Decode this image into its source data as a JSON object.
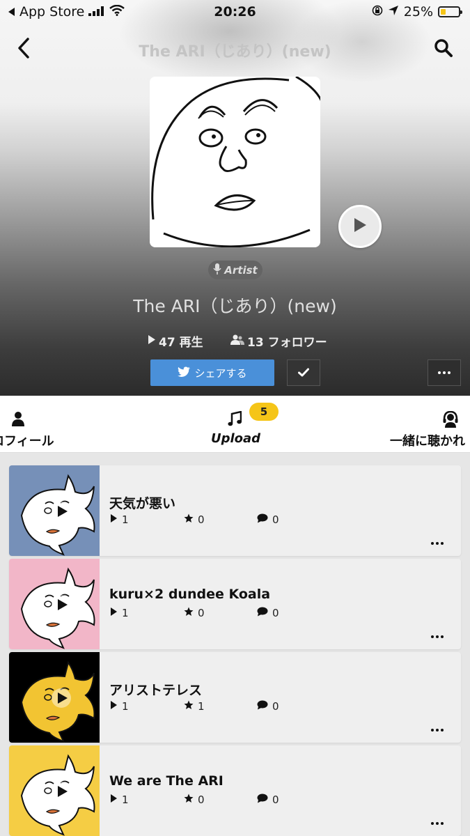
{
  "status_bar": {
    "back_app": "App Store",
    "time": "20:26",
    "battery": "25%"
  },
  "nav": {
    "title": "The ARI（じあり）(new)",
    "back_icon": "chevron-left-icon",
    "search_icon": "search-icon"
  },
  "artist": {
    "badge": "Artist",
    "name": "The ARI（じあり）(new)",
    "plays": "47 再生",
    "followers": "13 フォロワー"
  },
  "actions": {
    "share_label": "シェアする"
  },
  "tabs": [
    {
      "label": "ロフィール",
      "icon": "person-icon"
    },
    {
      "label": "Upload",
      "icon": "music-note-icon",
      "badge": "5"
    },
    {
      "label": "一緒に聴かれ",
      "icon": "headphones-icon"
    }
  ],
  "tracks": [
    {
      "title": "天気が悪い",
      "plays": "1",
      "likes": "0",
      "comments": "0",
      "thumb_color": "#7690b8",
      "fish_color": "#ffffff"
    },
    {
      "title": "kuru×2 dundee Koala",
      "plays": "1",
      "likes": "0",
      "comments": "0",
      "thumb_color": "#f2b6c8",
      "fish_color": "#ffffff"
    },
    {
      "title": "アリストテレス",
      "plays": "1",
      "likes": "1",
      "comments": "0",
      "thumb_color": "#000000",
      "fish_color": "#f2c432"
    },
    {
      "title": "We are The ARI",
      "plays": "1",
      "likes": "0",
      "comments": "0",
      "thumb_color": "#f5cd44",
      "fish_color": "#ffffff"
    }
  ],
  "colors": {
    "accent_share": "#4a90d9",
    "badge_yellow": "#f5c518"
  }
}
